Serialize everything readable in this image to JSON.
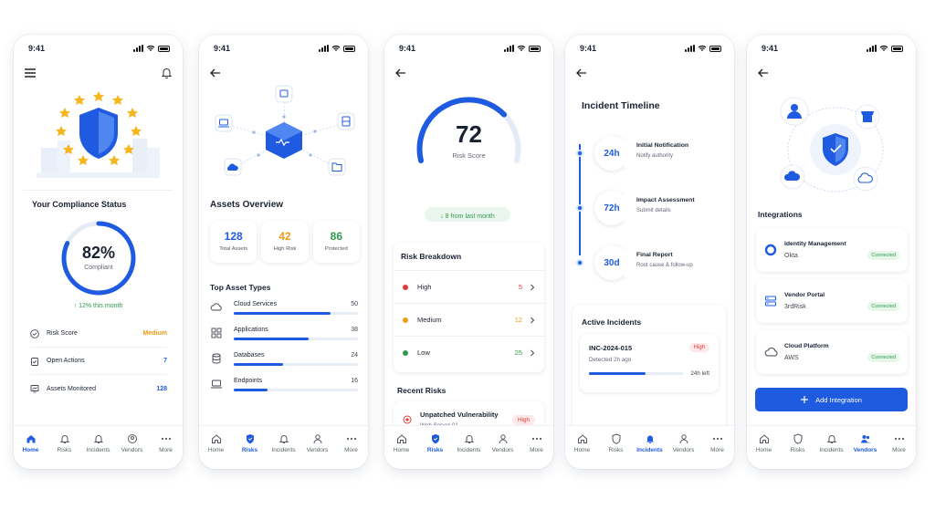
{
  "status_time": "9:41",
  "colors": {
    "accent": "#1f5be0",
    "green": "#2e9a4b",
    "orange": "#f29b14",
    "red": "#e03a3a"
  },
  "tabs": [
    "Home",
    "Risks",
    "Incidents",
    "Vendors",
    "More"
  ],
  "screen1": {
    "title": "Your Compliance Status",
    "percent": "82%",
    "percent_value": 82,
    "percent_label": "Compliant",
    "trend": "↑  12% this month",
    "rows": [
      {
        "label": "Risk Score",
        "value": "Medium"
      },
      {
        "label": "Open Actions",
        "value": "7"
      },
      {
        "label": "Assets Monitored",
        "value": "128"
      }
    ],
    "active_tab": "Home"
  },
  "screen2": {
    "title": "Assets Overview",
    "stats": [
      {
        "value": "128",
        "label": "Total Assets",
        "color": "#1f5be0"
      },
      {
        "value": "42",
        "label": "High Risk",
        "color": "#f29b14"
      },
      {
        "value": "86",
        "label": "Protected",
        "color": "#2e9a4b"
      }
    ],
    "types_title": "Top Asset Types",
    "types": [
      {
        "label": "Cloud Services",
        "value": "50",
        "fill": 0.78
      },
      {
        "label": "Applications",
        "value": "38",
        "fill": 0.6
      },
      {
        "label": "Databases",
        "value": "24",
        "fill": 0.4
      },
      {
        "label": "Endpoints",
        "value": "16",
        "fill": 0.27
      }
    ],
    "active_tab": "Risks"
  },
  "screen3": {
    "score": "72",
    "score_value": 72,
    "score_label": "Risk Score",
    "trend": "↓  8 from last month",
    "breakdown_title": "Risk Breakdown",
    "breakdown": [
      {
        "label": "High",
        "value": "5",
        "color": "#e03a3a"
      },
      {
        "label": "Medium",
        "value": "12",
        "color": "#f29b14"
      },
      {
        "label": "Low",
        "value": "25",
        "color": "#2e9a4b"
      }
    ],
    "recent_title": "Recent Risks",
    "recent": {
      "title": "Unpatched Vulnerability",
      "sub": "Web Server 01",
      "badge": "High"
    },
    "active_tab": "Risks"
  },
  "screen4": {
    "title": "Incident Timeline",
    "timeline": [
      {
        "time": "24h",
        "title": "Initial Notification",
        "sub": "Notify authority"
      },
      {
        "time": "72h",
        "title": "Impact Assessment",
        "sub": "Submit details"
      },
      {
        "time": "30d",
        "title": "Final Report",
        "sub": "Root cause & follow-up"
      }
    ],
    "active_title": "Active Incidents",
    "incident": {
      "id": "INC-2024-015",
      "badge": "High",
      "detected": "Detected 2h ago",
      "left": "24h left",
      "progress": 0.6
    },
    "active_tab": "Incidents"
  },
  "screen5": {
    "title": "Integrations",
    "items": [
      {
        "name": "Identity Management",
        "vendor": "Okta",
        "status": "Connected"
      },
      {
        "name": "Vendor Portal",
        "vendor": "3rdRisk",
        "status": "Connected"
      },
      {
        "name": "Cloud Platform",
        "vendor": "AWS",
        "status": "Connected"
      }
    ],
    "add_label": "Add Integration",
    "active_tab": "Vendors"
  }
}
